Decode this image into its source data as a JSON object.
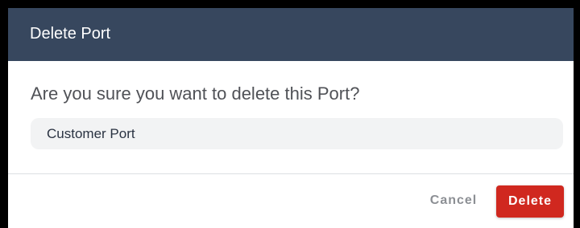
{
  "dialog": {
    "title": "Delete Port",
    "question": "Are you sure you want to delete this Port?",
    "item_name": "Customer Port"
  },
  "actions": {
    "cancel_label": "Cancel",
    "delete_label": "Delete"
  },
  "colors": {
    "header_background": "#37475e",
    "delete_button": "#d0281f",
    "item_box_background": "#f2f3f4"
  }
}
